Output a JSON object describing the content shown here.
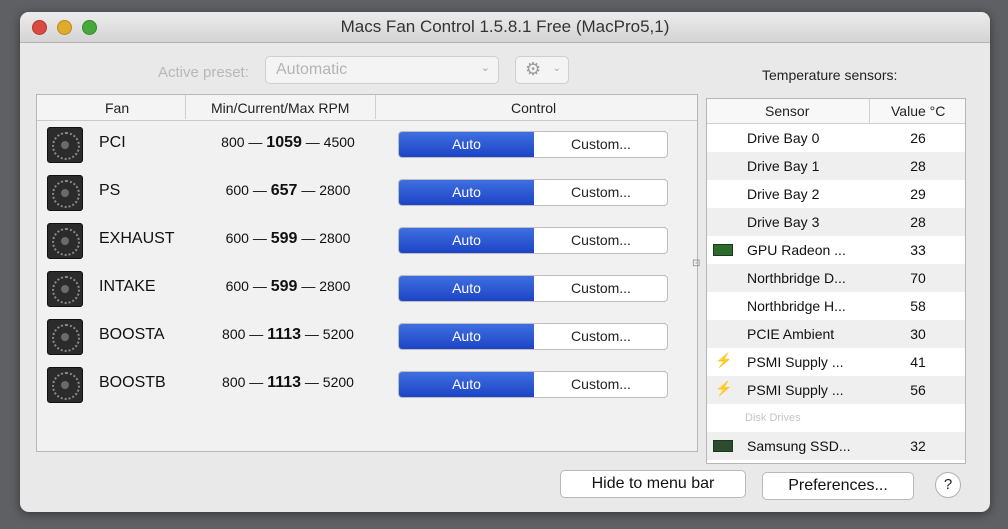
{
  "window": {
    "title": "Macs Fan Control 1.5.8.1 Free (MacPro5,1)"
  },
  "toolbar": {
    "preset_label": "Active preset:",
    "preset_value": "Automatic",
    "gear_icon": "gear-icon"
  },
  "fans": {
    "columns": [
      "Fan",
      "Min/Current/Max RPM",
      "Control"
    ],
    "rows": [
      {
        "name": "PCI",
        "min": "800",
        "current": "1059",
        "max": "4500",
        "auto": "Auto",
        "custom": "Custom..."
      },
      {
        "name": "PS",
        "min": "600",
        "current": "657",
        "max": "2800",
        "auto": "Auto",
        "custom": "Custom..."
      },
      {
        "name": "EXHAUST",
        "min": "600",
        "current": "599",
        "max": "2800",
        "auto": "Auto",
        "custom": "Custom..."
      },
      {
        "name": "INTAKE",
        "min": "600",
        "current": "599",
        "max": "2800",
        "auto": "Auto",
        "custom": "Custom..."
      },
      {
        "name": "BOOSTA",
        "min": "800",
        "current": "1113",
        "max": "5200",
        "auto": "Auto",
        "custom": "Custom..."
      },
      {
        "name": "BOOSTB",
        "min": "800",
        "current": "1113",
        "max": "5200",
        "auto": "Auto",
        "custom": "Custom..."
      }
    ],
    "separator": "—"
  },
  "sensors": {
    "title": "Temperature sensors:",
    "columns": [
      "Sensor",
      "Value °C"
    ],
    "rows": [
      {
        "name": "Drive Bay 0",
        "value": "26"
      },
      {
        "name": "Drive Bay 1",
        "value": "28"
      },
      {
        "name": "Drive Bay 2",
        "value": "29"
      },
      {
        "name": "Drive Bay 3",
        "value": "28"
      },
      {
        "name": "GPU Radeon ...",
        "value": "33"
      },
      {
        "name": "Northbridge D...",
        "value": "70"
      },
      {
        "name": "Northbridge H...",
        "value": "58"
      },
      {
        "name": "PCIE Ambient",
        "value": "30"
      },
      {
        "name": "PSMI Supply ...",
        "value": "41"
      },
      {
        "name": "PSMI Supply ...",
        "value": "56"
      }
    ],
    "group_label": "Disk Drives",
    "disk_rows": [
      {
        "name": "Samsung SSD...",
        "value": "32"
      }
    ]
  },
  "footer": {
    "hide_label": "Hide to menu bar",
    "preferences_label": "Preferences...",
    "help_label": "?"
  }
}
